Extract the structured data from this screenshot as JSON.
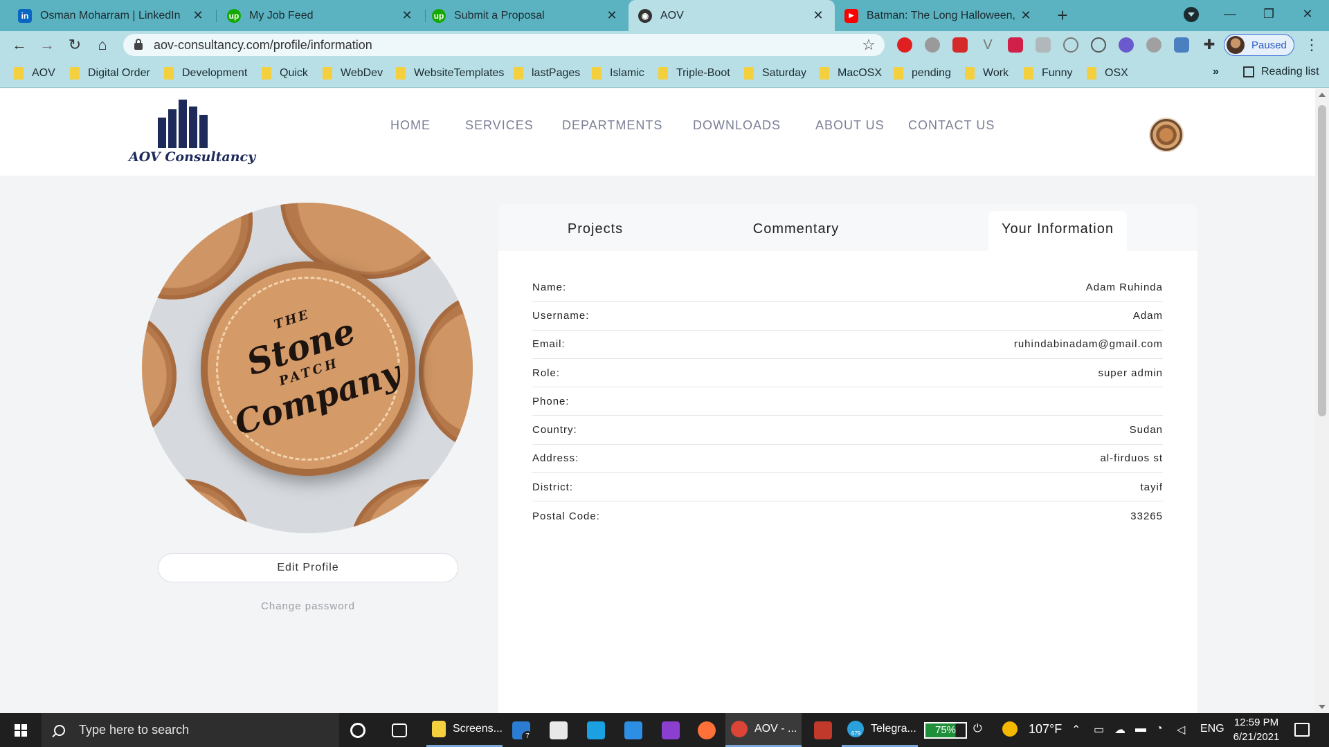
{
  "browser": {
    "tabs": [
      {
        "title": "Osman Moharram | LinkedIn",
        "icon": "linkedin-icon",
        "icon_color": "#0a66c2",
        "icon_glyph": "in"
      },
      {
        "title": "My Job Feed",
        "icon": "upwork-icon",
        "icon_color": "#14a800",
        "icon_glyph": "up"
      },
      {
        "title": "Submit a Proposal",
        "icon": "upwork-icon",
        "icon_color": "#14a800",
        "icon_glyph": "up"
      },
      {
        "title": "AOV",
        "icon": "globe-icon",
        "icon_color": "#333333",
        "icon_glyph": "◉"
      },
      {
        "title": "Batman: The Long Halloween, Pa",
        "icon": "youtube-icon",
        "icon_color": "#ff0000",
        "icon_glyph": "▶"
      }
    ],
    "url": "aov-consultancy.com/profile/information",
    "profile_label": "Paused",
    "bookmarks": [
      "AOV",
      "Digital Order",
      "Development",
      "Quick",
      "WebDev",
      "WebsiteTemplates",
      "lastPages",
      "Islamic",
      "Triple-Boot",
      "Saturday",
      "MacOSX",
      "pending",
      "Work",
      "Funny",
      "OSX"
    ],
    "bookmarks_more": "»",
    "reading_list": "Reading list"
  },
  "site": {
    "logo_text": "AOV Consultancy",
    "nav": [
      "HOME",
      "SERVICES",
      "DEPARTMENTS",
      "DOWNLOADS",
      "ABOUT US",
      "CONTACT US"
    ]
  },
  "profile": {
    "photo_text": {
      "the": "THE",
      "stone": "Stone",
      "patch": "PATCH",
      "company": "Company"
    },
    "edit_button": "Edit Profile",
    "change_password": "Change password",
    "tabs": [
      "Projects",
      "Commentary",
      "Your Information"
    ],
    "active_tab": "Your Information",
    "fields": [
      {
        "label": "Name:",
        "value": "Adam Ruhinda"
      },
      {
        "label": "Username:",
        "value": "Adam"
      },
      {
        "label": "Email:",
        "value": "ruhindabinadam@gmail.com"
      },
      {
        "label": "Role:",
        "value": "super admin"
      },
      {
        "label": "Phone:",
        "value": ""
      },
      {
        "label": "Country:",
        "value": "Sudan"
      },
      {
        "label": "Address:",
        "value": "al-firduos st"
      },
      {
        "label": "District:",
        "value": "tayif"
      },
      {
        "label": "Postal Code:",
        "value": "33265"
      }
    ]
  },
  "taskbar": {
    "search_placeholder": "Type here to search",
    "apps": [
      {
        "label": "Screens...",
        "icon": "folder-icon",
        "color": "#f4d03f"
      },
      {
        "label": "AOV - ...",
        "icon": "chrome-icon",
        "color": "#db4437"
      },
      {
        "label": "Telegra...",
        "icon": "telegram-icon",
        "color": "#2aa1da"
      }
    ],
    "mail_badge": "7",
    "telegram_badge": "679",
    "battery": "75%",
    "temperature": "107°F",
    "language": "ENG",
    "time": "12:59 PM",
    "date": "6/21/2021"
  }
}
